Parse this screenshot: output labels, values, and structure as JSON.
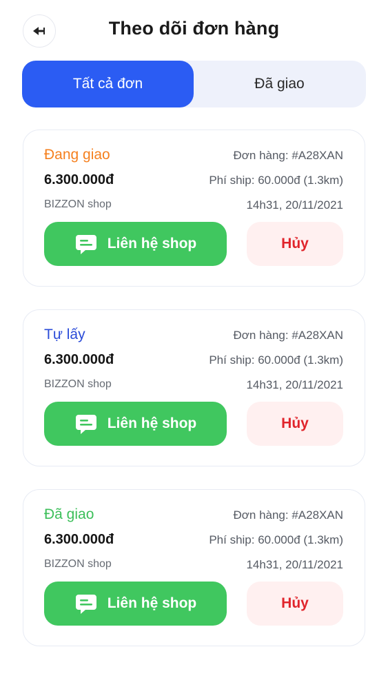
{
  "header": {
    "title": "Theo dõi đơn hàng",
    "back_icon": "back-arrow-icon"
  },
  "tabs": [
    {
      "label": "Tất cả đơn",
      "active": true
    },
    {
      "label": "Đã giao",
      "active": false
    }
  ],
  "orders": [
    {
      "status": "Đang giao",
      "status_color": "#f5801f",
      "order_no": "Đơn hàng: #A28XAN",
      "price": "6.300.000đ",
      "ship": "Phí ship: 60.000đ (1.3km)",
      "shop": "BIZZON shop",
      "time": "14h31, 20/11/2021",
      "contact_label": "Liên hệ shop",
      "cancel_label": "Hủy"
    },
    {
      "status": "Tự lấy",
      "status_color": "#2a4bd8",
      "order_no": "Đơn hàng: #A28XAN",
      "price": "6.300.000đ",
      "ship": "Phí ship: 60.000đ (1.3km)",
      "shop": "BIZZON shop",
      "time": "14h31, 20/11/2021",
      "contact_label": "Liên hệ shop",
      "cancel_label": "Hủy"
    },
    {
      "status": "Đã giao",
      "status_color": "#3cbf5a",
      "order_no": "Đơn hàng: #A28XAN",
      "price": "6.300.000đ",
      "ship": "Phí ship: 60.000đ (1.3km)",
      "shop": "BIZZON shop",
      "time": "14h31, 20/11/2021",
      "contact_label": "Liên hệ shop",
      "cancel_label": "Hủy"
    }
  ],
  "colors": {
    "accent": "#2b5cf3",
    "contact_button": "#40c75f",
    "cancel_text": "#e0242b",
    "cancel_bg": "#fff0f0"
  }
}
